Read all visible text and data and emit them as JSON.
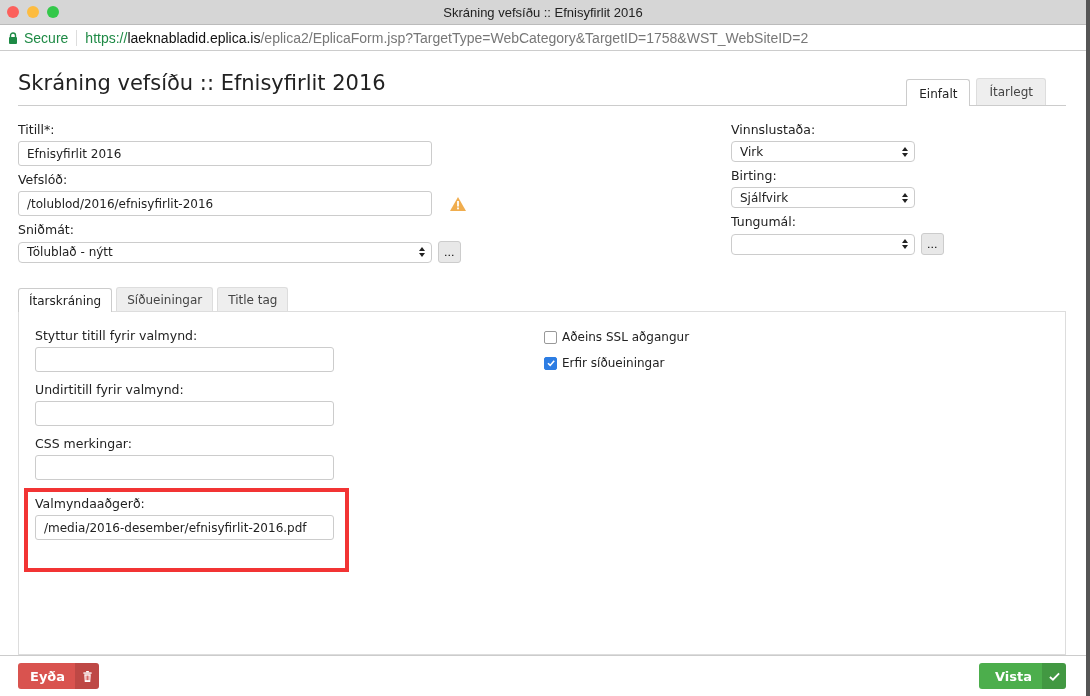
{
  "window": {
    "title": "Skráning vefsíðu :: Efnisyfirlit 2016"
  },
  "address_bar": {
    "secure_label": "Secure",
    "scheme": "https://",
    "host": "laeknabladid.eplica.is",
    "path": "/eplica2/EplicaForm.jsp?TargetType=WebCategory&TargetID=1758&WST_WebSiteID=2"
  },
  "page": {
    "heading": "Skráning vefsíðu :: Efnisyfirlit 2016",
    "mode_tabs": [
      {
        "label": "Einfalt",
        "selected": true
      },
      {
        "label": "Ítarlegt",
        "selected": false
      }
    ],
    "left_fields": [
      {
        "kind": "text",
        "label": "Titill*:",
        "value": "Efnisyfirlit 2016"
      },
      {
        "kind": "text",
        "label": "Vefslóð:",
        "value": "/tolublod/2016/efnisyfirlit-2016",
        "warning": true
      },
      {
        "kind": "select",
        "label": "Sniðmát:",
        "value": "Tölublað - nýtt",
        "more_button": "..."
      }
    ],
    "right_fields": [
      {
        "kind": "select",
        "label": "Vinnslustaða:",
        "value": "Virk"
      },
      {
        "kind": "select",
        "label": "Birting:",
        "value": "Sjálfvirk"
      },
      {
        "kind": "select",
        "label": "Tungumál:",
        "more_button": "..."
      }
    ],
    "section_tabs": [
      {
        "label": "Ítarskráning",
        "selected": true
      },
      {
        "label": "Síðueiningar",
        "selected": false
      },
      {
        "label": "Title tag",
        "selected": false
      }
    ],
    "detail_fields": [
      {
        "label": "Styttur titill fyrir valmynd:"
      },
      {
        "label": "Undirtitill fyrir valmynd:"
      },
      {
        "label": "CSS merkingar:"
      },
      {
        "label": "Valmyndaaðgerð:",
        "value": "/media/2016-desember/efnisyfirlit-2016.pdf",
        "highlighted": true
      }
    ],
    "checkboxes": [
      {
        "label": "Aðeins SSL aðgangur",
        "checked": false
      },
      {
        "label": "Erfir síðueiningar",
        "checked": true
      }
    ]
  },
  "footer": {
    "delete_button": "Eyða",
    "save_button": "Vista"
  }
}
